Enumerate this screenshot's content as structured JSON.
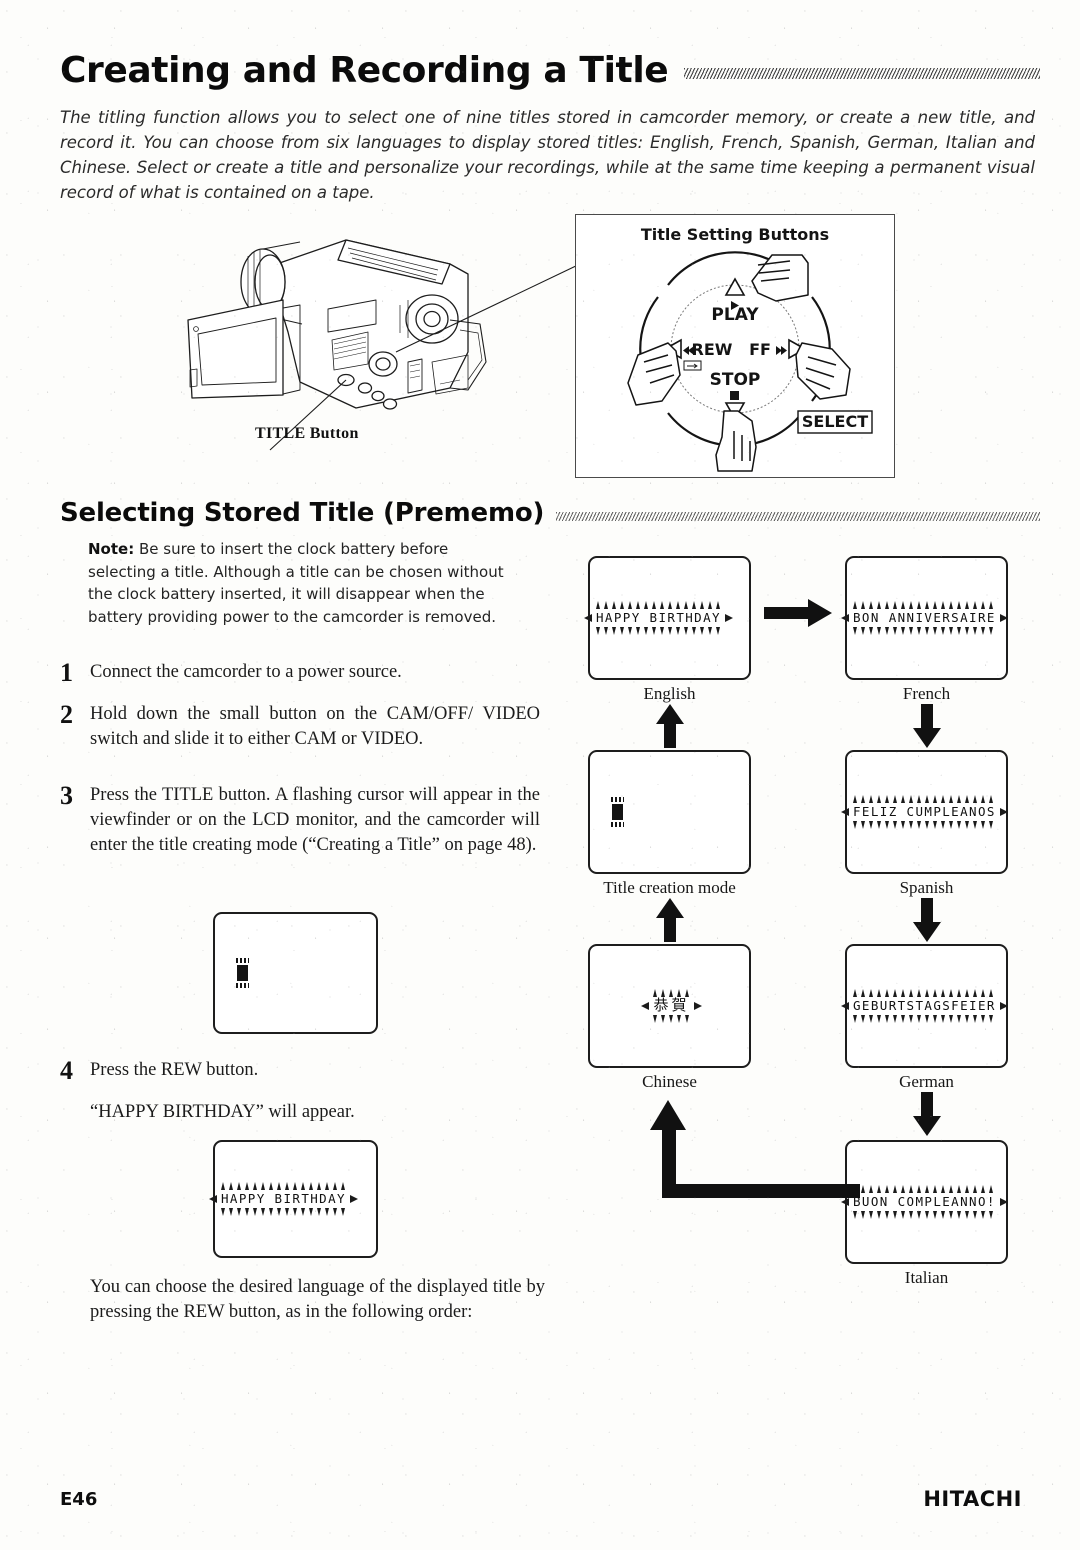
{
  "header": {
    "title": "Creating and Recording a Title",
    "intro": "The titling function allows you to select one of nine titles stored in camcorder memory, or create a new title, and record it.  You can choose from six languages to display stored titles: English, French, Spanish, German, Italian and Chinese.  Select or create a title and personalize your recordings, while at the same time keeping a permanent visual record of what is contained on a tape."
  },
  "figure_camcorder": {
    "title_button_label": "TITLE Button"
  },
  "title_setting_buttons": {
    "heading": "Title Setting Buttons",
    "play_label": "PLAY",
    "rew_label": "REW",
    "ff_label": "FF",
    "stop_label": "STOP",
    "select_label": "SELECT"
  },
  "section": {
    "heading": "Selecting Stored Title (Prememo)",
    "note_label": "Note:",
    "note_text": " Be sure to insert the clock battery before selecting a title. Although a title can be chosen without the clock battery inserted, it will disappear when the battery providing power to the camcorder is removed."
  },
  "steps": [
    {
      "num": "1",
      "text": "Connect the camcorder to a power source."
    },
    {
      "num": "2",
      "text": "Hold down the small button on the CAM/OFF/ VIDEO switch and slide it to either CAM or VIDEO."
    },
    {
      "num": "3",
      "text": "Press the TITLE button. A flashing cursor will appear in the viewfinder or on the LCD monitor, and the camcorder will enter the title creating mode (“Creating a Title” on page 48)."
    },
    {
      "num": "4",
      "text": "Press the REW button."
    }
  ],
  "body": {
    "happy_line": "“HAPPY BIRTHDAY” will appear.",
    "order_line": "You can choose the desired language of the displayed title by pressing the REW button, as in the following order:"
  },
  "language_flow": {
    "screens": [
      {
        "id": "english",
        "caption": "English",
        "text": "HAPPY BIRTHDAY",
        "cjk": false,
        "cursor": false
      },
      {
        "id": "french",
        "caption": "French",
        "text": "BON ANNIVERSAIRE",
        "cjk": false,
        "cursor": false
      },
      {
        "id": "creation",
        "caption": "Title creation mode",
        "text": "",
        "cjk": false,
        "cursor": true
      },
      {
        "id": "spanish",
        "caption": "Spanish",
        "text": "FELIZ CUMPLEANOS",
        "cjk": false,
        "cursor": false
      },
      {
        "id": "chinese",
        "caption": "Chinese",
        "text": "恭賀",
        "cjk": true,
        "cursor": false
      },
      {
        "id": "german",
        "caption": "German",
        "text": "GEBURTSTAGSFEIER",
        "cjk": false,
        "cursor": false
      },
      {
        "id": "italian",
        "caption": "Italian",
        "text": "BUON COMPLEANNO!",
        "cjk": false,
        "cursor": false
      }
    ]
  },
  "inline_screens": {
    "step3_cursor": "",
    "step4_title": "HAPPY BIRTHDAY"
  },
  "footer": {
    "page": "E46",
    "brand": "HITACHI"
  }
}
